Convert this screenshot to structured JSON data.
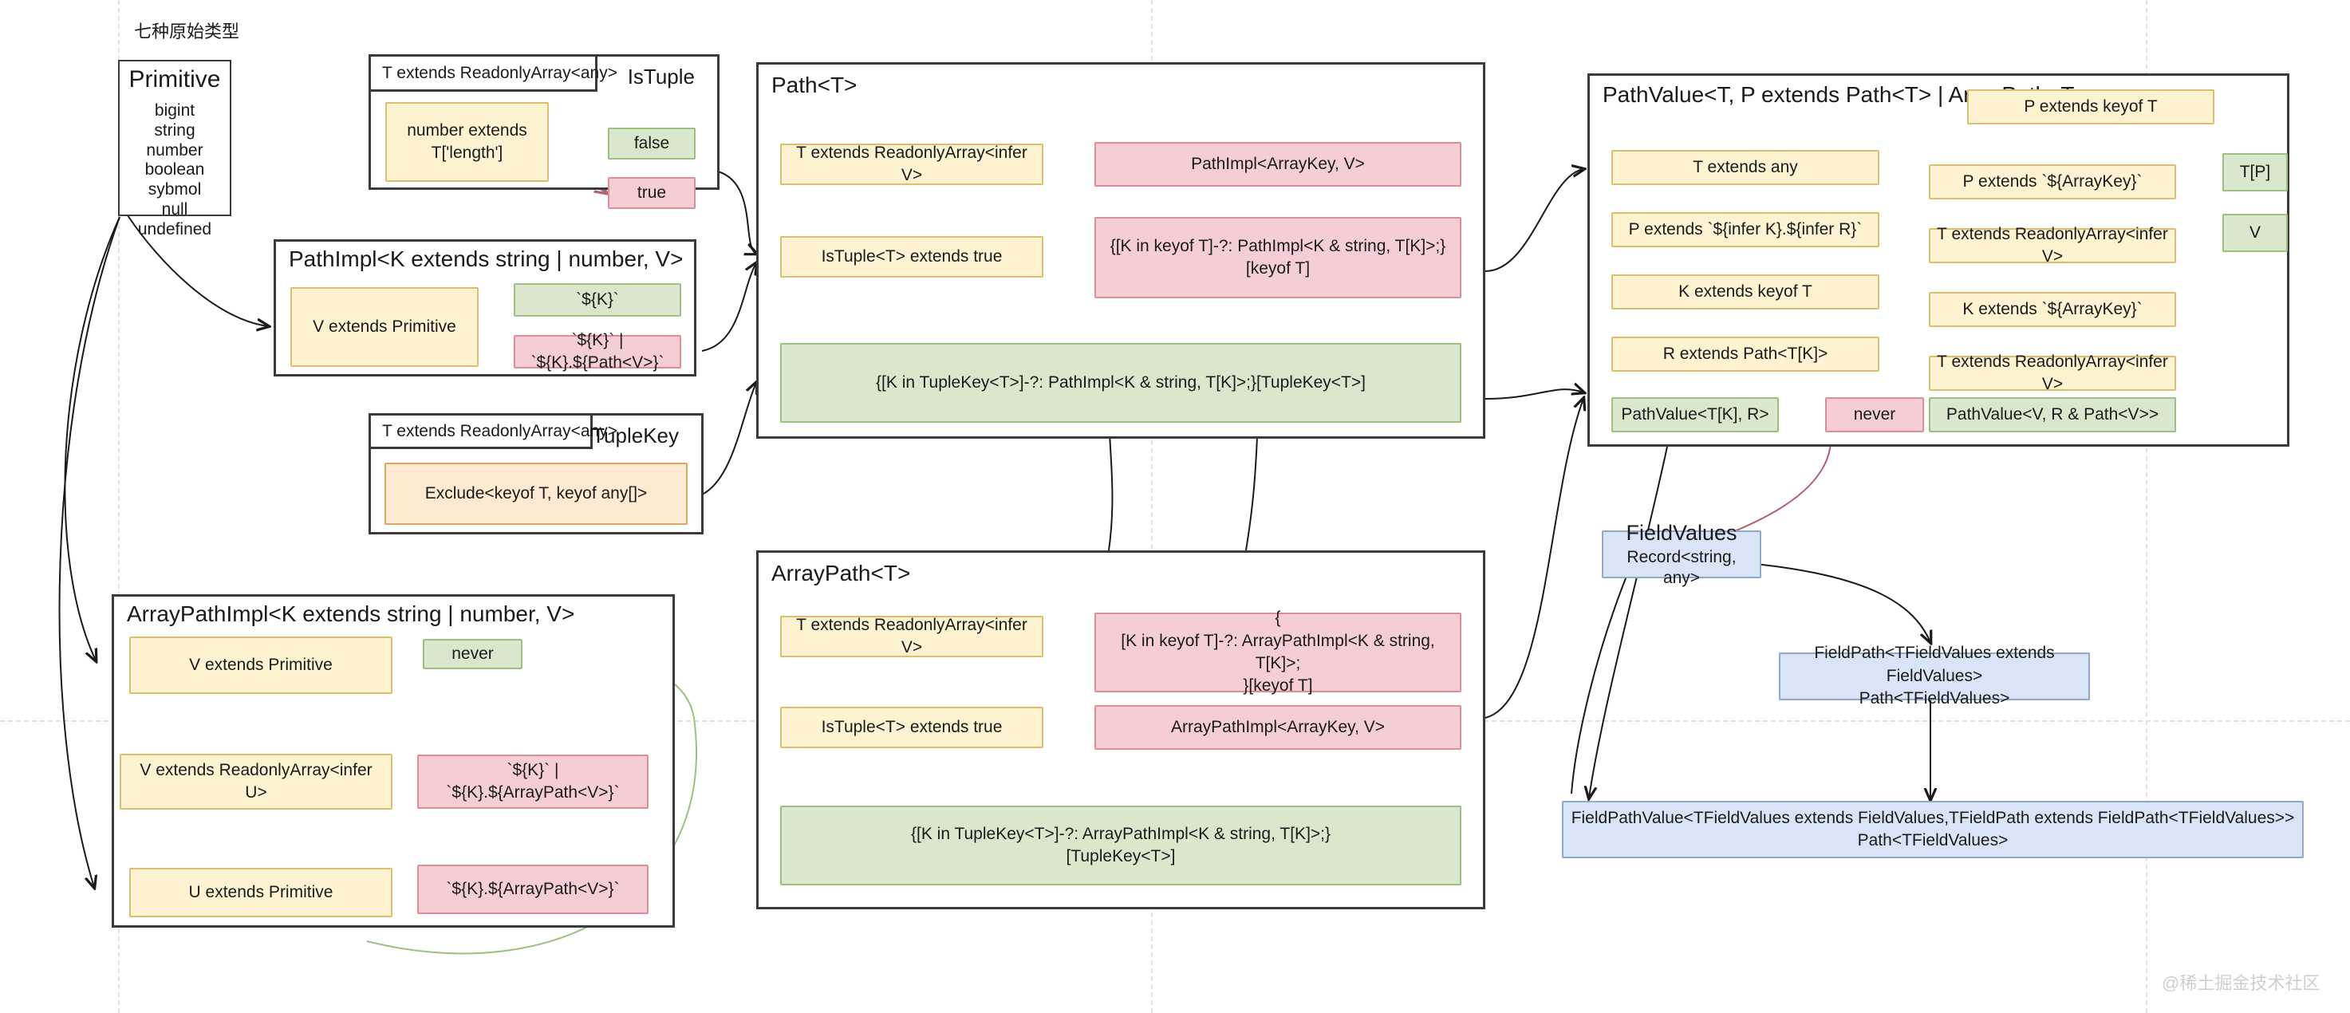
{
  "meta": {
    "watermark": "@稀土掘金技术社区"
  },
  "primitive": {
    "caption": "七种原始类型",
    "title": "Primitive",
    "items": [
      "bigint",
      "string",
      "number",
      "boolean",
      "sybmol",
      "null",
      "undefined"
    ]
  },
  "groups": {
    "is_tuple": {
      "tab": "T extends ReadonlyArray<any>",
      "title": "IsTuple",
      "nodes": {
        "cond": "number extends\nT['length']",
        "false": "false",
        "true": "true"
      }
    },
    "path_impl": {
      "title": "PathImpl<K extends string | number, V>",
      "nodes": {
        "cond": "V extends Primitive",
        "yes": "`${K}`",
        "no": "`${K}` | `${K}.${Path<V>}`"
      }
    },
    "tuple_key": {
      "tab": "T extends ReadonlyArray<any>",
      "title": "TupleKey",
      "nodes": {
        "result": "Exclude<keyof T, keyof any[]>"
      }
    },
    "array_path_impl": {
      "title": "ArrayPathImpl<K extends string | number, V>",
      "nodes": {
        "cond1": "V extends Primitive",
        "never": "never",
        "cond2": "V extends ReadonlyArray<infer U>",
        "res2": "`${K}` | `${K}.${ArrayPath<V>}`",
        "cond3": "U extends Primitive",
        "res3": "`${K}.${ArrayPath<V>}`"
      }
    },
    "path": {
      "title": "Path<T>",
      "nodes": {
        "cond1": "T extends ReadonlyArray<infer V>",
        "res1": "PathImpl<ArrayKey, V>",
        "cond2": "IsTuple<T> extends true",
        "res2": "{[K in keyof T]-?: PathImpl<K & string, T[K]>;}\n[keyof T]",
        "res3": "{[K in TupleKey<T>]-?: PathImpl<K & string, T[K]>;}[TupleKey<T>]"
      }
    },
    "array_path": {
      "title": "ArrayPath<T>",
      "nodes": {
        "cond1": "T extends ReadonlyArray<infer V>",
        "res1": "{\n[K in keyof T]-?: ArrayPathImpl<K & string, T[K]>;\n}[keyof T]",
        "cond2": "IsTuple<T> extends true",
        "res2": "ArrayPathImpl<ArrayKey, V>",
        "res3": "{[K in TupleKey<T>]-?: ArrayPathImpl<K & string, T[K]>;}\n[TupleKey<T>]"
      }
    },
    "path_value": {
      "title": "PathValue<T, P extends Path<T> | ArrayPath<T>>",
      "nodes": {
        "l1": "T extends any",
        "l2": "P extends `${infer K}.${infer R}`",
        "l3": "K extends keyof T",
        "l4": "R extends Path<T[K]>",
        "l5": "PathValue<T[K], R>",
        "never": "never",
        "r1": "P extends keyof T",
        "r2": "P extends `${ArrayKey}`",
        "r3": "T extends ReadonlyArray<infer V>",
        "r4": "K extends `${ArrayKey}`",
        "r5": "T extends ReadonlyArray<infer V>",
        "r6": "PathValue<V, R & Path<V>>",
        "out1": "T[P]",
        "out2": "V"
      }
    }
  },
  "standalone": {
    "field_values": {
      "title": "FieldValues",
      "subtitle": "Record<string, any>"
    },
    "field_path": "FieldPath<TFieldValues extends FieldValues>\nPath<TFieldValues>",
    "field_path_value": "FieldPathValue<TFieldValues extends FieldValues,TFieldPath extends FieldPath<TFieldValues>>\nPath<TFieldValues>"
  },
  "colors": {
    "yellow": "#fdf3d0",
    "green": "#d9e8cd",
    "red": "#f5ced3",
    "orange": "#fdead0",
    "blue": "#d9e5f7",
    "frame": "#3b3b3b",
    "edge_green": "#7fa75f",
    "edge_red": "#b4616e",
    "edge_black": "#1a1a1a"
  }
}
